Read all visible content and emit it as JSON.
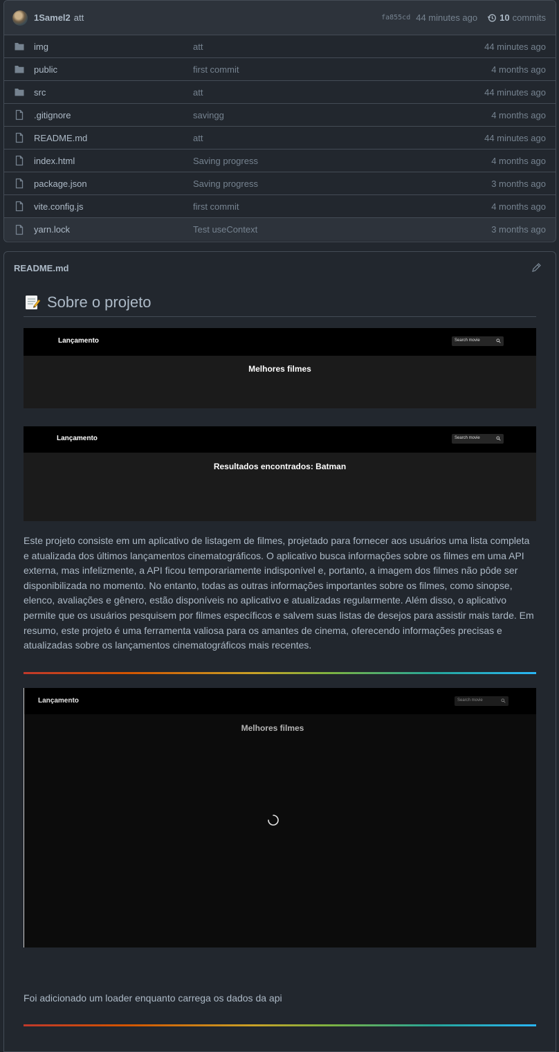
{
  "commit": {
    "author": "1Samel2",
    "message": "att",
    "sha": "fa855cd",
    "time": "44 minutes ago",
    "commits_count": "10",
    "commits_label": "commits"
  },
  "files": [
    {
      "name": "img",
      "type": "folder",
      "message": "att",
      "age": "44 minutes ago"
    },
    {
      "name": "public",
      "type": "folder",
      "message": "first commit",
      "age": "4 months ago"
    },
    {
      "name": "src",
      "type": "folder",
      "message": "att",
      "age": "44 minutes ago"
    },
    {
      "name": ".gitignore",
      "type": "file",
      "message": "savingg",
      "age": "4 months ago"
    },
    {
      "name": "README.md",
      "type": "file",
      "message": "att",
      "age": "44 minutes ago"
    },
    {
      "name": "index.html",
      "type": "file",
      "message": "Saving progress",
      "age": "4 months ago"
    },
    {
      "name": "package.json",
      "type": "file",
      "message": "Saving progress",
      "age": "3 months ago"
    },
    {
      "name": "vite.config.js",
      "type": "file",
      "message": "first commit",
      "age": "4 months ago"
    },
    {
      "name": "yarn.lock",
      "type": "file",
      "message": "Test useContext",
      "age": "3 months ago"
    }
  ],
  "readme": {
    "filename": "README.md",
    "heading": "Sobre o projeto",
    "screenshots": [
      {
        "brand": "Lançamento",
        "search_placeholder": "Search movie",
        "title": "Melhores filmes"
      },
      {
        "brand": "Lançamento",
        "search_placeholder": "Search movie",
        "title": "Resultados encontrados: Batman"
      },
      {
        "brand": "Lançamento",
        "search_placeholder": "Search movie",
        "title": "Melhores filmes"
      }
    ],
    "paragraph": "Este projeto consiste em um aplicativo de listagem de filmes, projetado para fornecer aos usuários uma lista completa e atualizada dos últimos lançamentos cinematográficos. O aplicativo busca informações sobre os filmes em uma API externa, mas infelizmente, a API ficou temporariamente indisponível e, portanto, a imagem dos filmes não pôde ser disponibilizada no momento. No entanto, todas as outras informações importantes sobre os filmes, como sinopse, elenco, avaliações e gênero, estão disponíveis no aplicativo e atualizadas regularmente. Além disso, o aplicativo permite que os usuários pesquisem por filmes específicos e salvem suas listas de desejos para assistir mais tarde. Em resumo, este projeto é uma ferramenta valiosa para os amantes de cinema, oferecendo informações precisas e atualizadas sobre os lançamentos cinematográficos mais recentes.",
    "loader_note": "Foi adicionado um loader enquanto carrega os dados da api"
  },
  "colors": {
    "background": "#22272e",
    "header_bg": "#2d333b",
    "border": "#444c56",
    "text": "#adbac7",
    "muted": "#768390"
  }
}
